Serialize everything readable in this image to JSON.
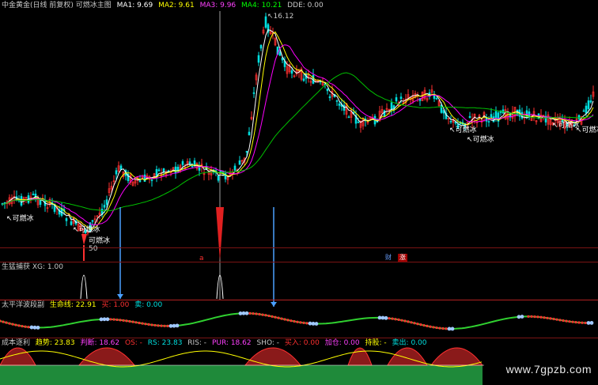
{
  "main": {
    "title": "中金黄金(日线 前复权) 可燃冰主图",
    "ma": [
      {
        "label": "MA1: 9.69",
        "color": "#ffffff"
      },
      {
        "label": "MA2: 9.61",
        "color": "#ffff00"
      },
      {
        "label": "MA3: 9.96",
        "color": "#ff00ff"
      },
      {
        "label": "MA4: 10.21",
        "color": "#00ff00"
      },
      {
        "label": "DDE: 0.00",
        "color": "#c8c8c8"
      }
    ],
    "high_label": "16.12",
    "low_label": "50",
    "signal_label": "可燃冰",
    "signals": [
      "可燃冰",
      "可燃冰",
      "可燃冰",
      "可燃冰",
      "可燃冰",
      "可燃冰",
      "可燃冰"
    ],
    "badge_cai": "财",
    "badge_zhang": "涨"
  },
  "panel_xg": {
    "title": "生猛捕获",
    "value": "XG: 1.00"
  },
  "panel_tp": {
    "title": "太平洋波段副",
    "life_line": "生命线: 22.91",
    "buy": "买: 1.00",
    "sell": "卖: 0.00"
  },
  "panel_cost": {
    "title": "成本逐利",
    "trend": "趋势: 23.83",
    "judge": "判断: 18.62",
    "os": "OS: -",
    "rs": "RS: 23.83",
    "ris": "RIS: -",
    "pur": "PUR: 18.62",
    "sho": "SHO: -",
    "buy_in": "买入: 0.00",
    "add_pos": "加仓: 0.00",
    "hold": "持股: -",
    "sell_out": "卖出: 0.00"
  },
  "watermark": "www.7gpzb.com",
  "colors": {
    "up": "#ff3030",
    "down": "#00e0e0",
    "ma1": "#ffffff",
    "ma2": "#ffff00",
    "ma3": "#ff00ff",
    "ma4": "#00c000",
    "panel_border": "#7a1414",
    "arrow": "#4aa0ff"
  }
}
